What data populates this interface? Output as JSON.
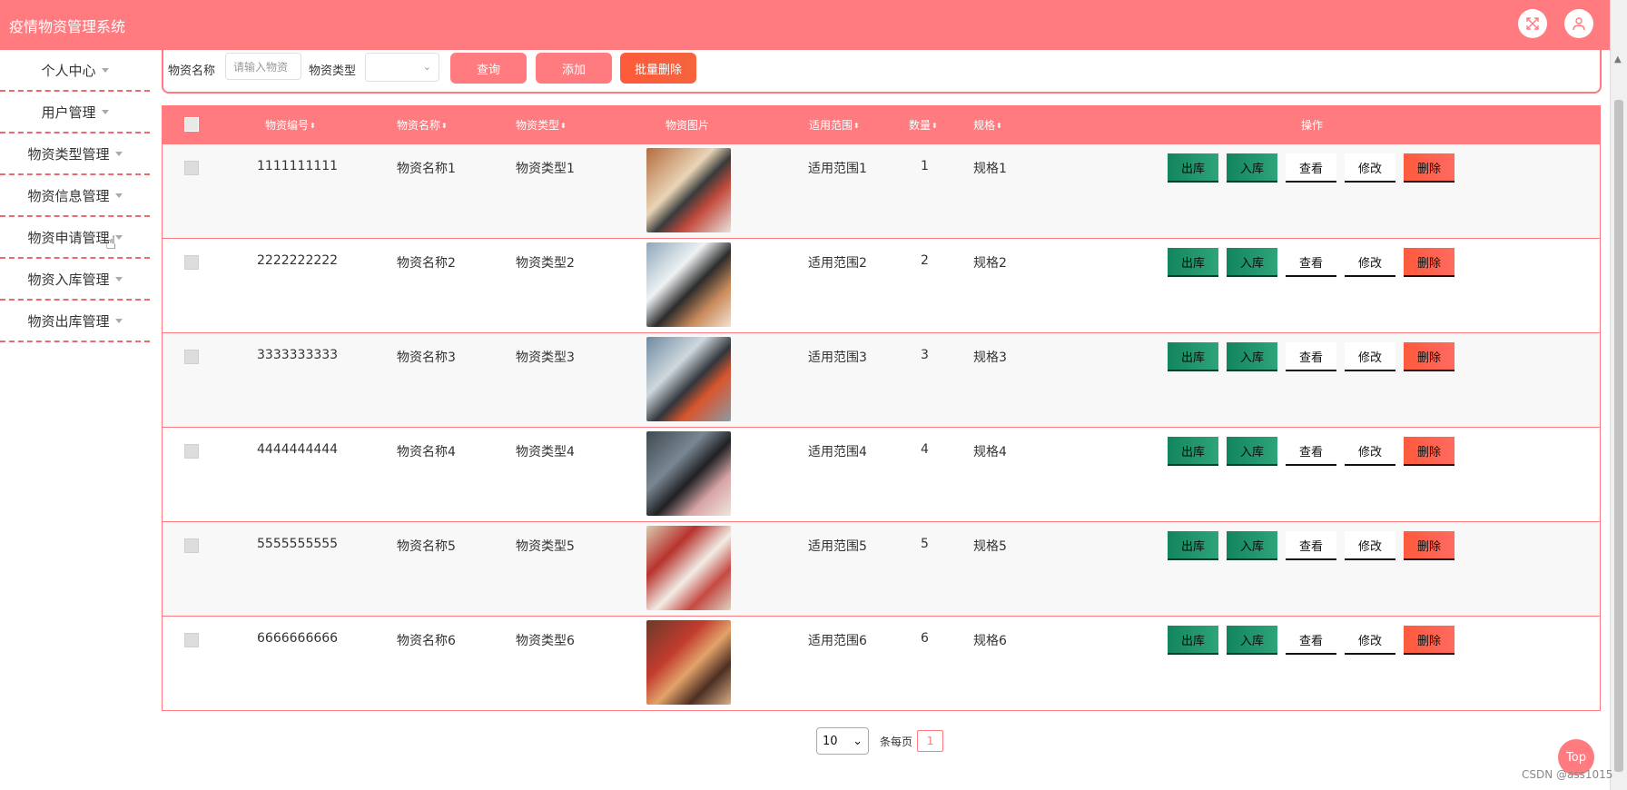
{
  "app": {
    "title": "疫情物资管理系统"
  },
  "header": {
    "icons": [
      "fullscreen-icon",
      "user-icon"
    ]
  },
  "sidebar": {
    "items": [
      {
        "label": "个人中心"
      },
      {
        "label": "用户管理"
      },
      {
        "label": "物资类型管理"
      },
      {
        "label": "物资信息管理"
      },
      {
        "label": "物资申请管理"
      },
      {
        "label": "物资入库管理"
      },
      {
        "label": "物资出库管理"
      }
    ]
  },
  "search": {
    "name_label": "物资名称",
    "name_placeholder": "请输入物资",
    "type_label": "物资类型",
    "type_value": "",
    "query_btn": "查询",
    "add_btn": "添加",
    "batch_delete_btn": "批量删除"
  },
  "table": {
    "columns": [
      "物资编号",
      "物资名称",
      "物资类型",
      "物资图片",
      "适用范围",
      "数量",
      "规格",
      "操作"
    ],
    "rows": [
      {
        "code": "1111111111",
        "name": "物资名称1",
        "type": "物资类型1",
        "scope": "适用范围1",
        "qty": "1",
        "spec": "规格1"
      },
      {
        "code": "2222222222",
        "name": "物资名称2",
        "type": "物资类型2",
        "scope": "适用范围2",
        "qty": "2",
        "spec": "规格2"
      },
      {
        "code": "3333333333",
        "name": "物资名称3",
        "type": "物资类型3",
        "scope": "适用范围3",
        "qty": "3",
        "spec": "规格3"
      },
      {
        "code": "4444444444",
        "name": "物资名称4",
        "type": "物资类型4",
        "scope": "适用范围4",
        "qty": "4",
        "spec": "规格4"
      },
      {
        "code": "5555555555",
        "name": "物资名称5",
        "type": "物资类型5",
        "scope": "适用范围5",
        "qty": "5",
        "spec": "规格5"
      },
      {
        "code": "6666666666",
        "name": "物资名称6",
        "type": "物资类型6",
        "scope": "适用范围6",
        "qty": "6",
        "spec": "规格6"
      }
    ],
    "actions": {
      "out": "出库",
      "in": "入库",
      "view": "查看",
      "edit": "修改",
      "delete": "删除"
    }
  },
  "pagination": {
    "page_size": "10",
    "per_page_label": "条每页",
    "current_page": "1"
  },
  "top_button": "Top",
  "watermark": "CSDN @ass1015",
  "colors": {
    "primary": "#ff7b7f",
    "green": "#13855e",
    "danger": "#ff5a3c"
  }
}
